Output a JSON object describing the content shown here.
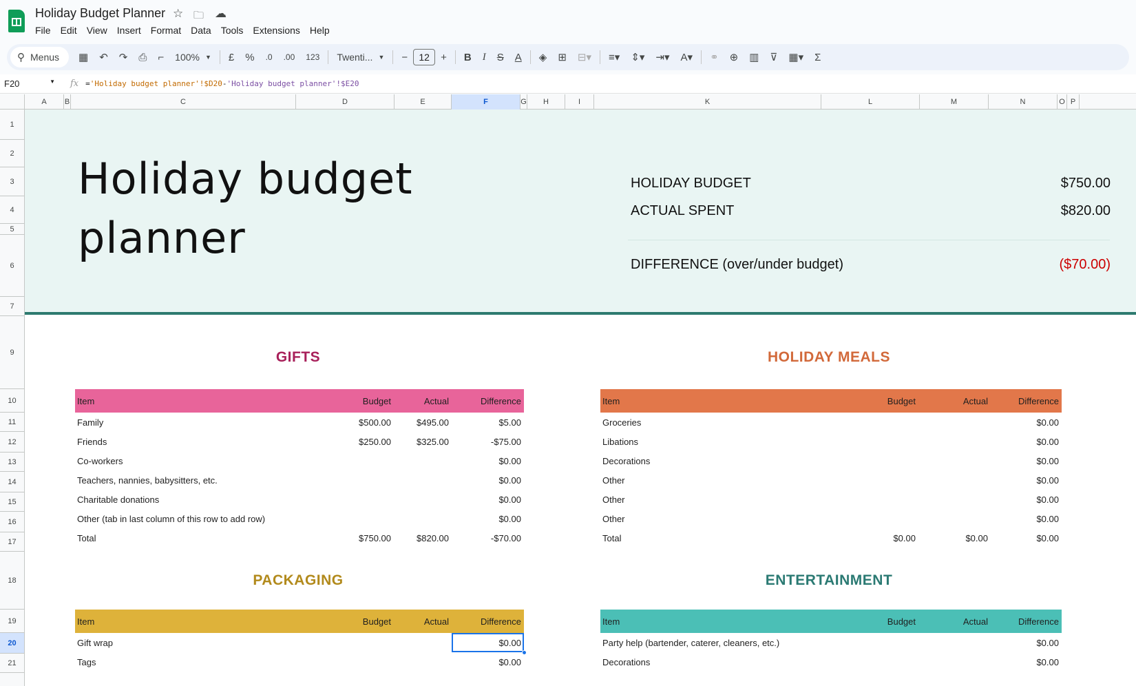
{
  "app": {
    "doc_title": "Holiday Budget Planner",
    "menu": [
      "File",
      "Edit",
      "View",
      "Insert",
      "Format",
      "Data",
      "Tools",
      "Extensions",
      "Help"
    ]
  },
  "toolbar": {
    "menus_label": "Menus",
    "zoom": "100%",
    "currency": "£",
    "percent": "%",
    "dec_decrease": ".0",
    "dec_increase": ".00",
    "format_123": "123",
    "font": "Twenti...",
    "font_size": "12",
    "bold": "B",
    "italic": "I",
    "sum": "Σ"
  },
  "formula_bar": {
    "cell_ref": "F20",
    "fx": "fx",
    "formula_prefix": "=",
    "ref1": "'Holiday budget planner'!$D20",
    "minus": "-",
    "ref2": "'Holiday budget planner'!$E20"
  },
  "columns": [
    "A",
    "B",
    "C",
    "D",
    "E",
    "F",
    "G",
    "H",
    "I",
    "K",
    "L",
    "M",
    "N",
    "O",
    "P"
  ],
  "rows": [
    "1",
    "2",
    "3",
    "4",
    "5",
    "6",
    "7",
    "9",
    "10",
    "11",
    "12",
    "13",
    "14",
    "15",
    "16",
    "17",
    "18",
    "19",
    "20",
    "21"
  ],
  "selected_column": "F",
  "selected_row": "20",
  "hero": {
    "title_line1": "Holiday budget",
    "title_line2": "planner",
    "budget_label": "HOLIDAY BUDGET",
    "budget_value": "$750.00",
    "spent_label": "ACTUAL SPENT",
    "spent_value": "$820.00",
    "diff_label": "DIFFERENCE (over/under budget)",
    "diff_value": "($70.00)"
  },
  "colors": {
    "gifts": "#e8649a",
    "gifts_title": "#a8205a",
    "meals": "#e2774a",
    "meals_title": "#d2693a",
    "packaging": "#deb23a",
    "packaging_title": "#b28a1c",
    "entertainment": "#4bbfb6",
    "entertainment_title": "#2b7a73",
    "hero_bg": "#e9f5f3",
    "hero_border": "#2d7a6f",
    "negative": "#cc0000"
  },
  "headers": {
    "item": "Item",
    "budget": "Budget",
    "actual": "Actual",
    "difference": "Difference"
  },
  "gifts": {
    "title": "GIFTS",
    "rows": [
      {
        "item": "Family",
        "budget": "$500.00",
        "actual": "$495.00",
        "diff": "$5.00"
      },
      {
        "item": "Friends",
        "budget": "$250.00",
        "actual": "$325.00",
        "diff": "-$75.00"
      },
      {
        "item": "Co-workers",
        "budget": "",
        "actual": "",
        "diff": "$0.00"
      },
      {
        "item": "Teachers, nannies, babysitters, etc.",
        "budget": "",
        "actual": "",
        "diff": "$0.00"
      },
      {
        "item": "Charitable donations",
        "budget": "",
        "actual": "",
        "diff": "$0.00"
      },
      {
        "item": "Other (tab in last column of this row to add row)",
        "budget": "",
        "actual": "",
        "diff": "$0.00"
      },
      {
        "item": "Total",
        "budget": "$750.00",
        "actual": "$820.00",
        "diff": "-$70.00"
      }
    ]
  },
  "meals": {
    "title": "HOLIDAY MEALS",
    "rows": [
      {
        "item": "Groceries",
        "budget": "",
        "actual": "",
        "diff": "$0.00"
      },
      {
        "item": "Libations",
        "budget": "",
        "actual": "",
        "diff": "$0.00"
      },
      {
        "item": "Decorations",
        "budget": "",
        "actual": "",
        "diff": "$0.00"
      },
      {
        "item": "Other",
        "budget": "",
        "actual": "",
        "diff": "$0.00"
      },
      {
        "item": "Other",
        "budget": "",
        "actual": "",
        "diff": "$0.00"
      },
      {
        "item": "Other",
        "budget": "",
        "actual": "",
        "diff": "$0.00"
      },
      {
        "item": "Total",
        "budget": "$0.00",
        "actual": "$0.00",
        "diff": "$0.00"
      }
    ]
  },
  "packaging": {
    "title": "PACKAGING",
    "rows": [
      {
        "item": "Gift wrap",
        "budget": "",
        "actual": "",
        "diff": "$0.00"
      },
      {
        "item": "Tags",
        "budget": "",
        "actual": "",
        "diff": "$0.00"
      }
    ]
  },
  "entertainment": {
    "title": "ENTERTAINMENT",
    "rows": [
      {
        "item": "Party help (bartender, caterer, cleaners, etc.)",
        "budget": "",
        "actual": "",
        "diff": "$0.00"
      },
      {
        "item": "Decorations",
        "budget": "",
        "actual": "",
        "diff": "$0.00"
      }
    ]
  }
}
